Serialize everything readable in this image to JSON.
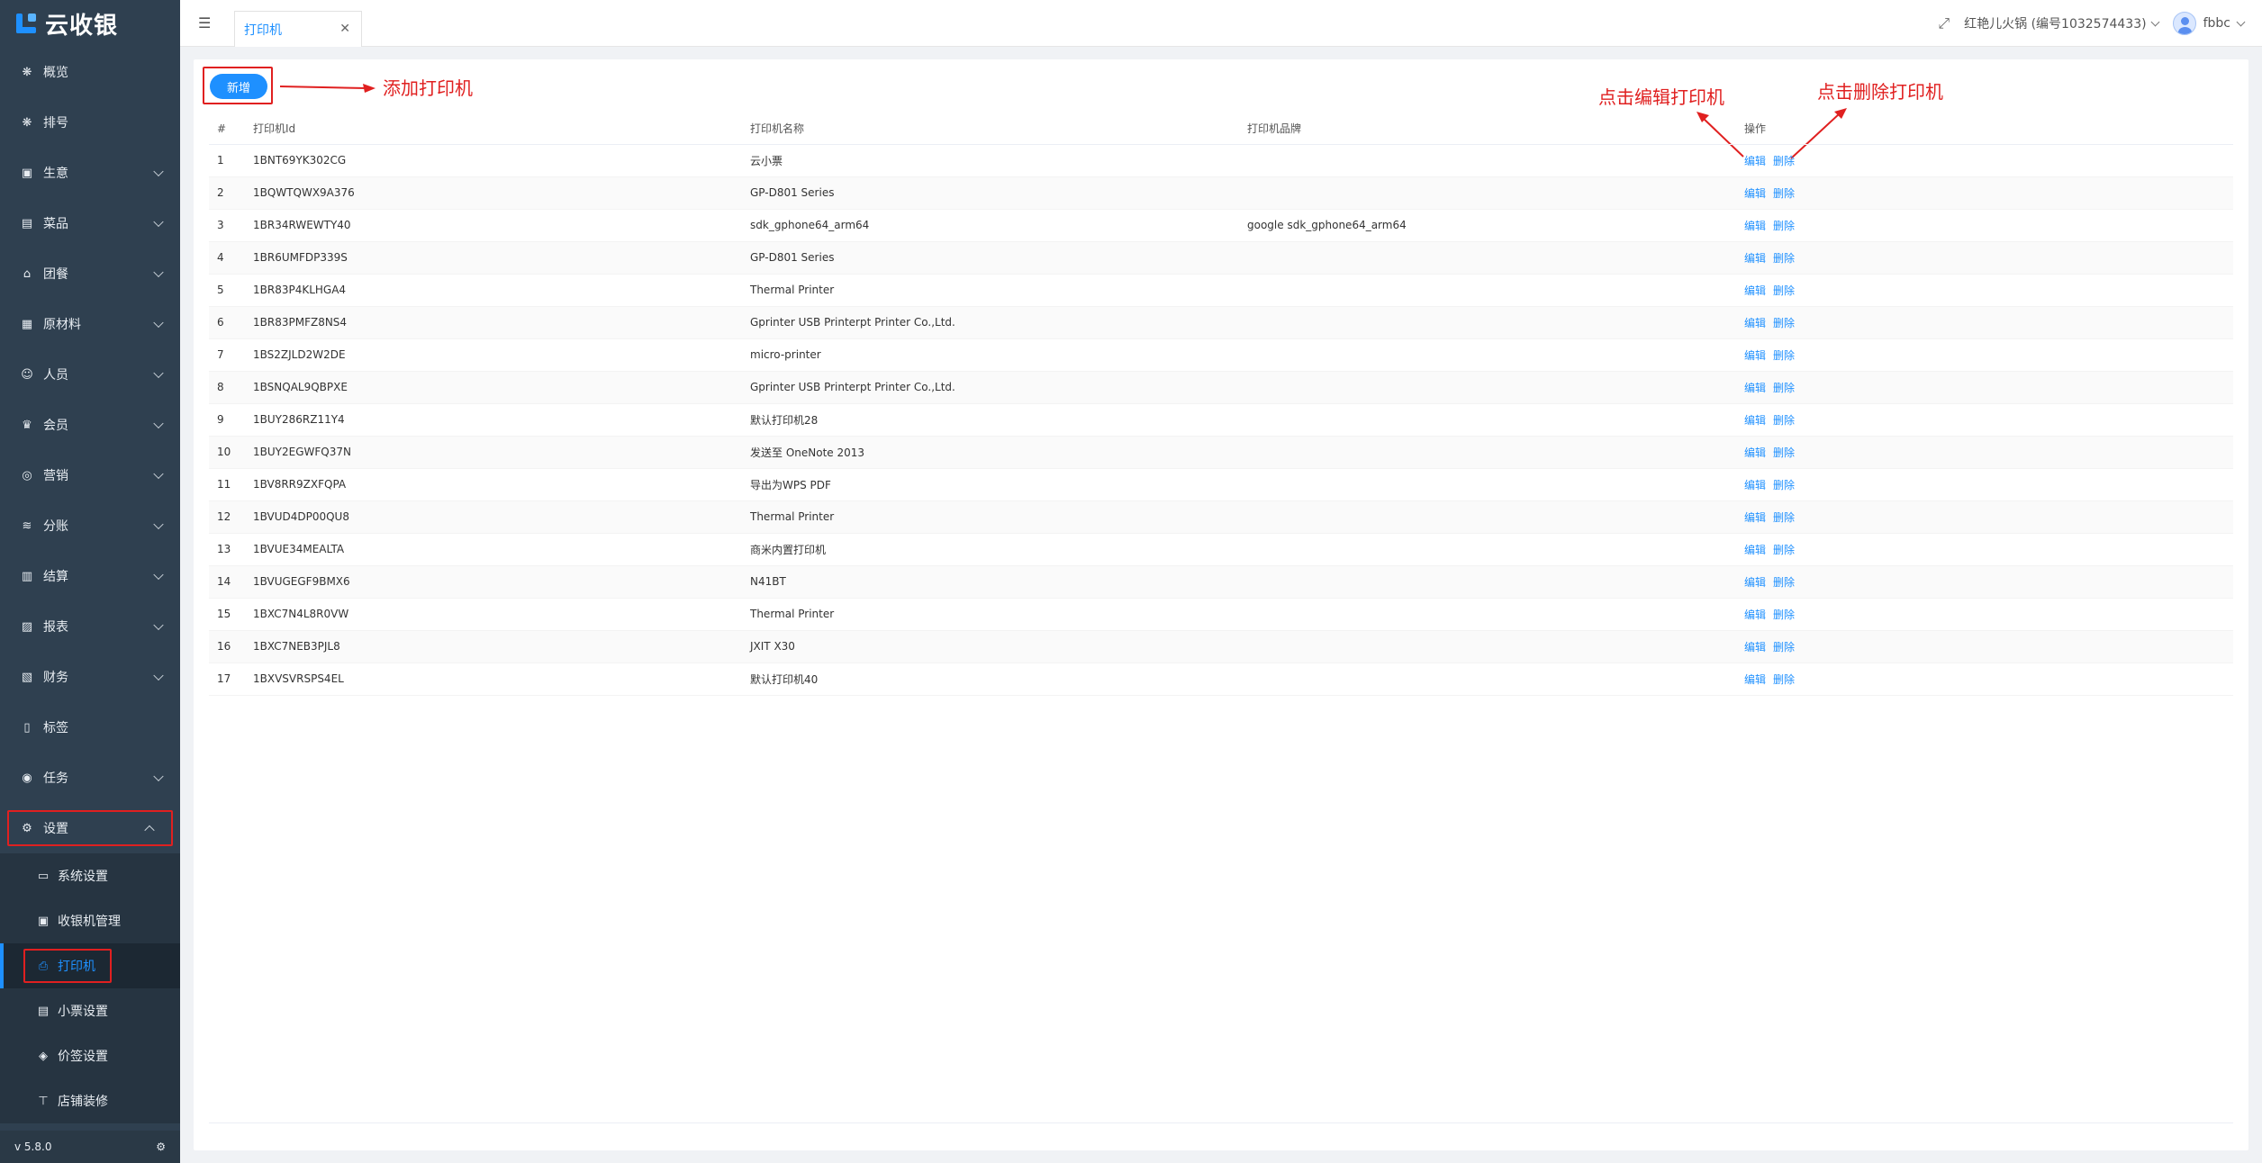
{
  "app": {
    "logo_text": "云收银",
    "version": "v 5.8.0"
  },
  "sidebar": {
    "items": [
      {
        "label": "概览",
        "icon": "overview-icon",
        "chevron": false
      },
      {
        "label": "排号",
        "icon": "queue-icon",
        "chevron": false
      },
      {
        "label": "生意",
        "icon": "business-icon",
        "chevron": true
      },
      {
        "label": "菜品",
        "icon": "dish-icon",
        "chevron": true
      },
      {
        "label": "团餐",
        "icon": "group-meal-icon",
        "chevron": true
      },
      {
        "label": "原材料",
        "icon": "materials-icon",
        "chevron": true
      },
      {
        "label": "人员",
        "icon": "staff-icon",
        "chevron": true
      },
      {
        "label": "会员",
        "icon": "member-icon",
        "chevron": true
      },
      {
        "label": "营销",
        "icon": "marketing-icon",
        "chevron": true
      },
      {
        "label": "分账",
        "icon": "split-account-icon",
        "chevron": true
      },
      {
        "label": "结算",
        "icon": "settlement-icon",
        "chevron": true
      },
      {
        "label": "报表",
        "icon": "report-icon",
        "chevron": true
      },
      {
        "label": "财务",
        "icon": "finance-icon",
        "chevron": true
      },
      {
        "label": "标签",
        "icon": "tag-icon",
        "chevron": false
      },
      {
        "label": "任务",
        "icon": "task-icon",
        "chevron": true
      }
    ],
    "settings": {
      "label": "设置",
      "icon": "gear-icon"
    },
    "submenu": [
      {
        "label": "系统设置",
        "icon": "monitor-icon"
      },
      {
        "label": "收银机管理",
        "icon": "cashier-icon"
      },
      {
        "label": "打印机",
        "icon": "printer-icon",
        "active": true
      },
      {
        "label": "小票设置",
        "icon": "receipt-icon"
      },
      {
        "label": "价签设置",
        "icon": "price-tag-icon"
      },
      {
        "label": "店铺装修",
        "icon": "shop-decor-icon"
      }
    ]
  },
  "header": {
    "tab_label": "打印机",
    "store_name": "红艳儿火锅 (编号1032574433)",
    "user_name": "fbbc"
  },
  "toolbar": {
    "add_label": "新增"
  },
  "annotations": {
    "add": "添加打印机",
    "edit": "点击编辑打印机",
    "delete": "点击删除打印机"
  },
  "table": {
    "headers": [
      "#",
      "打印机Id",
      "打印机名称",
      "打印机品牌",
      "操作"
    ],
    "edit_label": "编辑",
    "delete_label": "删除",
    "rows": [
      {
        "idx": "1",
        "id": "1BNT69YK302CG",
        "name": "云小票",
        "brand": ""
      },
      {
        "idx": "2",
        "id": "1BQWTQWX9A376",
        "name": "GP-D801 Series",
        "brand": ""
      },
      {
        "idx": "3",
        "id": "1BR34RWEWTY40",
        "name": "sdk_gphone64_arm64",
        "brand": "google sdk_gphone64_arm64"
      },
      {
        "idx": "4",
        "id": "1BR6UMFDP339S",
        "name": "GP-D801 Series",
        "brand": ""
      },
      {
        "idx": "5",
        "id": "1BR83P4KLHGA4",
        "name": "Thermal Printer",
        "brand": ""
      },
      {
        "idx": "6",
        "id": "1BR83PMFZ8NS4",
        "name": "Gprinter USB Printerpt Printer Co.,Ltd.",
        "brand": ""
      },
      {
        "idx": "7",
        "id": "1BS2ZJLD2W2DE",
        "name": "micro-printer",
        "brand": ""
      },
      {
        "idx": "8",
        "id": "1BSNQAL9QBPXE",
        "name": "Gprinter USB Printerpt Printer Co.,Ltd.",
        "brand": ""
      },
      {
        "idx": "9",
        "id": "1BUY286RZ11Y4",
        "name": "默认打印机28",
        "brand": ""
      },
      {
        "idx": "10",
        "id": "1BUY2EGWFQ37N",
        "name": "发送至 OneNote 2013",
        "brand": ""
      },
      {
        "idx": "11",
        "id": "1BV8RR9ZXFQPA",
        "name": "导出为WPS PDF",
        "brand": ""
      },
      {
        "idx": "12",
        "id": "1BVUD4DP00QU8",
        "name": "Thermal Printer",
        "brand": ""
      },
      {
        "idx": "13",
        "id": "1BVUE34MEALTA",
        "name": "商米内置打印机",
        "brand": ""
      },
      {
        "idx": "14",
        "id": "1BVUGEGF9BMX6",
        "name": "N41BT",
        "brand": ""
      },
      {
        "idx": "15",
        "id": "1BXC7N4L8R0VW",
        "name": "Thermal Printer",
        "brand": ""
      },
      {
        "idx": "16",
        "id": "1BXC7NEB3PJL8",
        "name": "JXIT X30",
        "brand": ""
      },
      {
        "idx": "17",
        "id": "1BXVSVRSPS4EL",
        "name": "默认打印机40",
        "brand": ""
      }
    ]
  },
  "colors": {
    "accent": "#1e90ff",
    "highlight": "#e02020",
    "sidebar_bg": "#2f4050"
  }
}
